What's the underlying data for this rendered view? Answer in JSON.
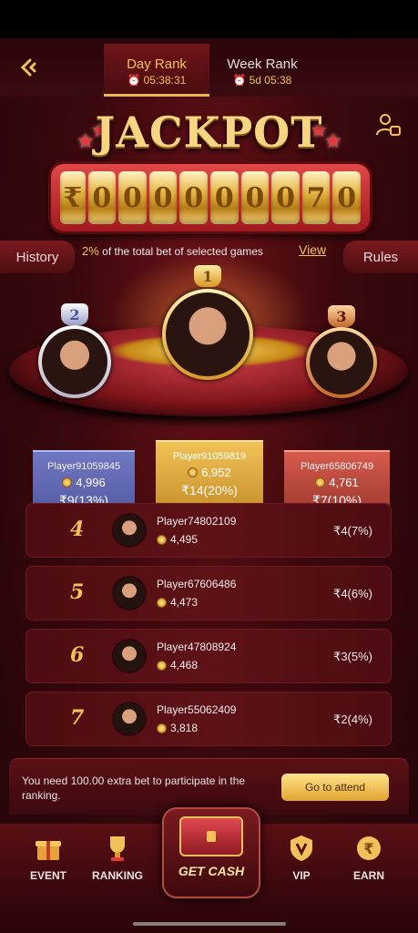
{
  "header": {
    "tabs": [
      {
        "label": "Day Rank",
        "timer": "05:38:31"
      },
      {
        "label": "Week Rank",
        "timer": "5d 05:38"
      }
    ]
  },
  "jackpot": {
    "title": "JACKPOT",
    "currency": "₹",
    "digits": [
      "0",
      "0",
      "0",
      "0",
      "0",
      "0",
      "0",
      "7",
      "0"
    ]
  },
  "hint": {
    "percent": "2%",
    "text": "of the total bet of selected games",
    "view": "View",
    "history": "History",
    "rules": "Rules"
  },
  "podium": [
    {
      "rank": "2",
      "name": "Player91059845",
      "score": "4,996",
      "prize": "₹9(13%)"
    },
    {
      "rank": "1",
      "name": "Player91059819",
      "score": "6,952",
      "prize": "₹14(20%)"
    },
    {
      "rank": "3",
      "name": "Player65806749",
      "score": "4,761",
      "prize": "₹7(10%)"
    }
  ],
  "ranking": [
    {
      "rank": "4",
      "name": "Player74802109",
      "score": "4,495",
      "prize": "₹4(7%)"
    },
    {
      "rank": "5",
      "name": "Player67606486",
      "score": "4,473",
      "prize": "₹4(6%)"
    },
    {
      "rank": "6",
      "name": "Player47808924",
      "score": "4,468",
      "prize": "₹3(5%)"
    },
    {
      "rank": "7",
      "name": "Player55062409",
      "score": "3,818",
      "prize": "₹2(4%)"
    }
  ],
  "attend": {
    "text": "You need 100.00 extra bet to participate in the ranking.",
    "amount": "100.00",
    "button": "Go to attend"
  },
  "nav": {
    "event": "EVENT",
    "ranking": "RANKING",
    "get_cash": "GET CASH",
    "vip": "VIP",
    "earn": "EARN"
  },
  "colors": {
    "gold": "#f2c25a",
    "background": "#3a080c",
    "silver_plinth": "#5b61ad",
    "gold_plinth": "#d9a13a",
    "bronze_plinth": "#b34539"
  }
}
